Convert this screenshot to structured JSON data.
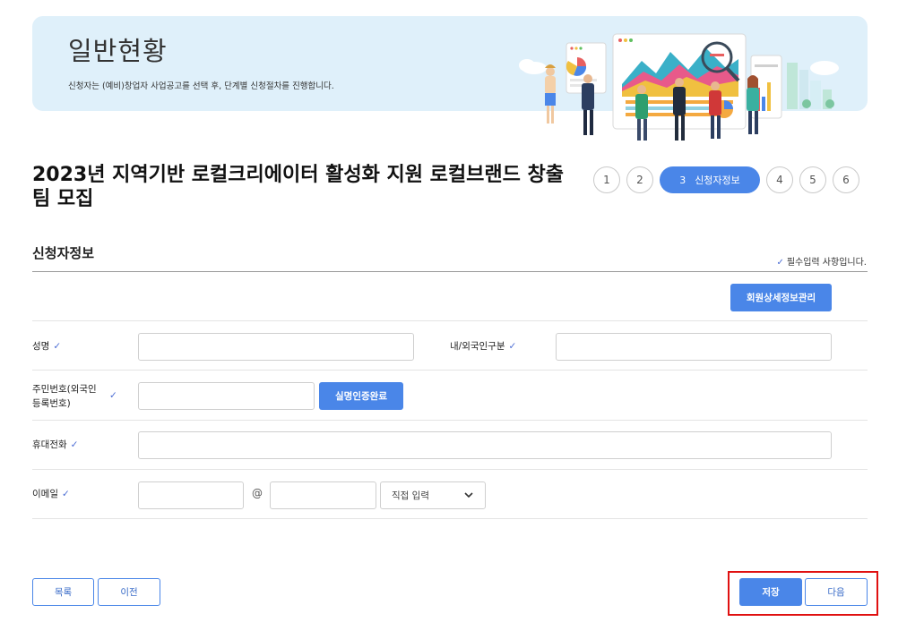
{
  "banner": {
    "title": "일반현황",
    "subtitle": "신청자는 (예비)창업자 사업공고를 선택 후, 단계별 신청절차를 진행합니다."
  },
  "page": {
    "title": "2023년 지역기반 로컬크리에이터 활성화 지원 로컬브랜드 창출 팀 모집"
  },
  "steps": [
    {
      "num": "1",
      "label": "",
      "active": false
    },
    {
      "num": "2",
      "label": "",
      "active": false
    },
    {
      "num": "3",
      "label": "신청자정보",
      "active": true
    },
    {
      "num": "4",
      "label": "",
      "active": false
    },
    {
      "num": "5",
      "label": "",
      "active": false
    },
    {
      "num": "6",
      "label": "",
      "active": false
    }
  ],
  "section": {
    "title": "신청자정보",
    "required_note": "필수입력 사항입니다.",
    "check_mark": "✓"
  },
  "buttons": {
    "member_detail": "회원상세정보관리",
    "real_name_cert": "실명인증완료",
    "list": "목록",
    "prev": "이전",
    "save": "저장",
    "next": "다음"
  },
  "form": {
    "name_label": "성명",
    "nationality_label": "내/외국인구분",
    "rrn_label_line1": "주민번호(외국인",
    "rrn_label_line2": "등록번호)",
    "phone_label": "휴대전화",
    "email_label": "이메일",
    "email_at": "@",
    "email_domain_select": "직접 입력"
  },
  "colors": {
    "accent": "#4a86e8",
    "banner_bg": "#dff0fa",
    "highlight": "#e01010",
    "check": "#4a6cd4"
  }
}
